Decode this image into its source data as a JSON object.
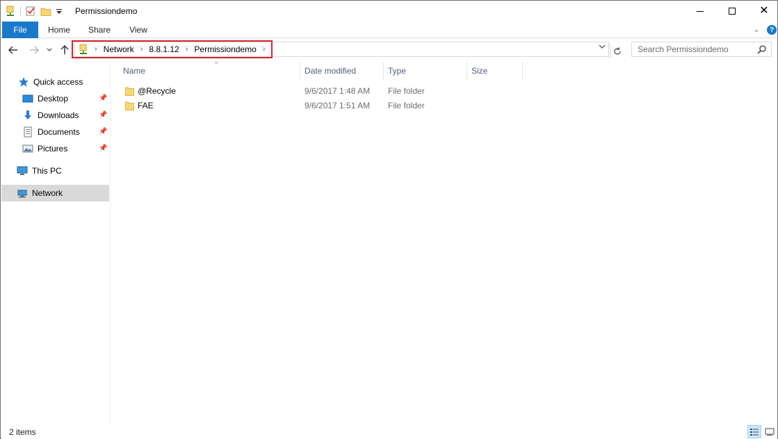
{
  "window": {
    "title": "Permissiondemo",
    "controls": {
      "minimize": "minimize",
      "maximize": "maximize",
      "close": "✕"
    }
  },
  "ribbon": {
    "tabs": [
      {
        "label": "File",
        "active": true
      },
      {
        "label": "Home"
      },
      {
        "label": "Share"
      },
      {
        "label": "View"
      }
    ]
  },
  "address": {
    "crumbs": [
      "Network",
      "8.8.1.12",
      "Permissiondemo"
    ],
    "highlight_color": "#d9232e"
  },
  "search": {
    "placeholder": "Search Permissiondemo"
  },
  "sidebar": {
    "items": [
      {
        "label": "Quick access",
        "icon": "star-icon"
      },
      {
        "label": "Desktop",
        "icon": "desktop-icon",
        "pinned": true
      },
      {
        "label": "Downloads",
        "icon": "download-icon",
        "pinned": true
      },
      {
        "label": "Documents",
        "icon": "documents-icon",
        "pinned": true
      },
      {
        "label": "Pictures",
        "icon": "pictures-icon",
        "pinned": true
      },
      {
        "label": "This PC",
        "icon": "computer-icon"
      },
      {
        "label": "Network",
        "icon": "network-icon",
        "selected": true
      }
    ]
  },
  "columns": [
    "Name",
    "Date modified",
    "Type",
    "Size"
  ],
  "files": [
    {
      "name": "@Recycle",
      "date": "9/6/2017 1:48 AM",
      "type": "File folder",
      "size": ""
    },
    {
      "name": "FAE",
      "date": "9/6/2017 1:51 AM",
      "type": "File folder",
      "size": ""
    }
  ],
  "status": {
    "item_count": "2 items"
  },
  "colors": {
    "accent": "#1979ca",
    "selected_nav": "#d9d9d9",
    "folder": "#f8d775"
  }
}
